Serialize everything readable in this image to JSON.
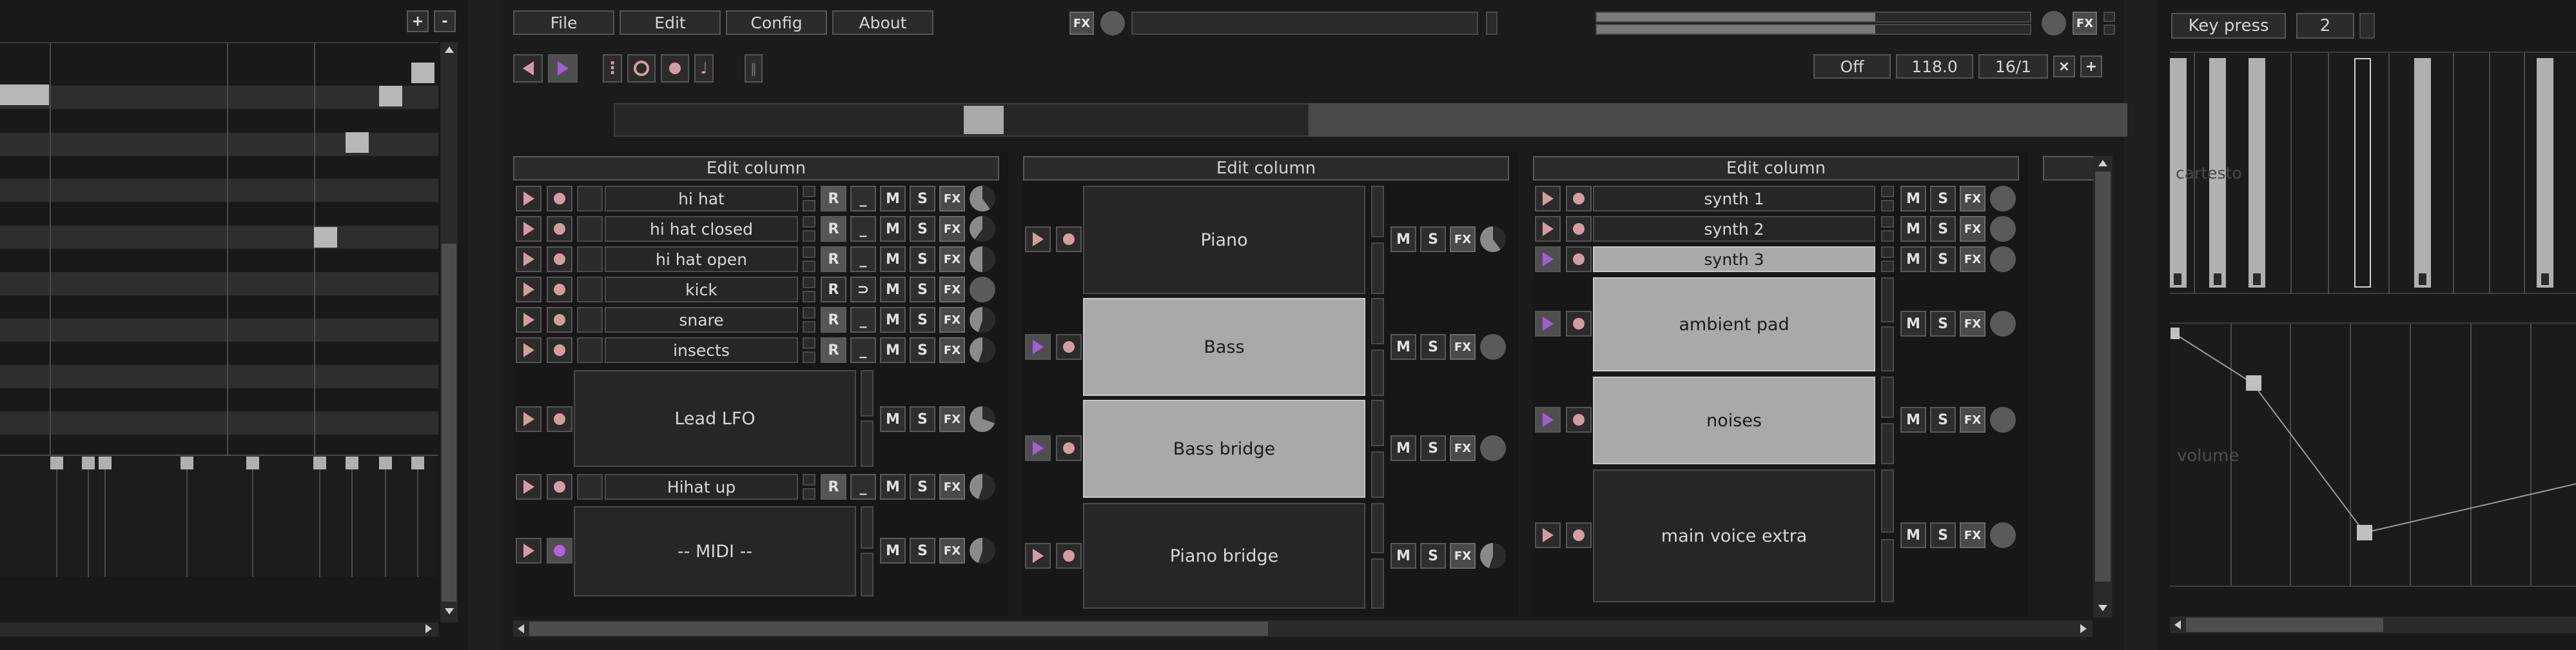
{
  "left_panel": {
    "zoom_in_label": "+",
    "zoom_out_label": "-"
  },
  "menu": {
    "file": "File",
    "edit": "Edit",
    "config": "Config",
    "about": "About"
  },
  "top_right_fx": "FX",
  "transport": {
    "sync_value": "Off",
    "bpm": "118.0",
    "beats": "16/1",
    "close_label": "×",
    "add_label": "+"
  },
  "columns": [
    {
      "header": "Edit column",
      "tracks": [
        {
          "name": "hi hat",
          "kind": "sample",
          "r": "R",
          "m": "M",
          "s": "S",
          "fx": "FX"
        },
        {
          "name": "hi hat closed",
          "kind": "sample",
          "r": "R",
          "m": "M",
          "s": "S",
          "fx": "FX"
        },
        {
          "name": "hi hat open",
          "kind": "sample",
          "r": "R",
          "m": "M",
          "s": "S",
          "fx": "FX"
        },
        {
          "name": "kick",
          "kind": "sample",
          "r": "R",
          "m": "M",
          "s": "S",
          "fx": "FX"
        },
        {
          "name": "snare",
          "kind": "sample",
          "r": "R",
          "m": "M",
          "s": "S",
          "fx": "FX"
        },
        {
          "name": "insects",
          "kind": "sample",
          "r": "R",
          "m": "M",
          "s": "S",
          "fx": "FX"
        },
        {
          "name": "Lead LFO",
          "kind": "big",
          "m": "M",
          "s": "S",
          "fx": "FX"
        },
        {
          "name": "Hihat up",
          "kind": "sample",
          "r": "R",
          "m": "M",
          "s": "S",
          "fx": "FX"
        },
        {
          "name": "-- MIDI --",
          "kind": "big",
          "m": "M",
          "s": "S",
          "fx": "FX"
        }
      ]
    },
    {
      "header": "Edit column",
      "tracks": [
        {
          "name": "Piano",
          "m": "M",
          "s": "S",
          "fx": "FX"
        },
        {
          "name": "Bass",
          "m": "M",
          "s": "S",
          "fx": "FX"
        },
        {
          "name": "Bass bridge",
          "m": "M",
          "s": "S",
          "fx": "FX"
        },
        {
          "name": "Piano bridge",
          "m": "M",
          "s": "S",
          "fx": "FX"
        }
      ]
    },
    {
      "header": "Edit column",
      "tracks": [
        {
          "name": "synth 1",
          "m": "M",
          "s": "S",
          "fx": "FX"
        },
        {
          "name": "synth 2",
          "m": "M",
          "s": "S",
          "fx": "FX"
        },
        {
          "name": "synth 3",
          "m": "M",
          "s": "S",
          "fx": "FX"
        },
        {
          "name": "ambient pad",
          "m": "M",
          "s": "S",
          "fx": "FX"
        },
        {
          "name": "noises",
          "m": "M",
          "s": "S",
          "fx": "FX"
        },
        {
          "name": "main voice extra",
          "m": "M",
          "s": "S",
          "fx": "FX"
        }
      ]
    }
  ],
  "right_panel": {
    "key_press_label": "Key press",
    "key_press_value": "2",
    "faded_label_top": "cartesto",
    "envelope_label": "volume"
  },
  "colors": {
    "play_idle": "#d49ca2",
    "play_active": "#a55bd6",
    "background": "#1f1f1f"
  }
}
